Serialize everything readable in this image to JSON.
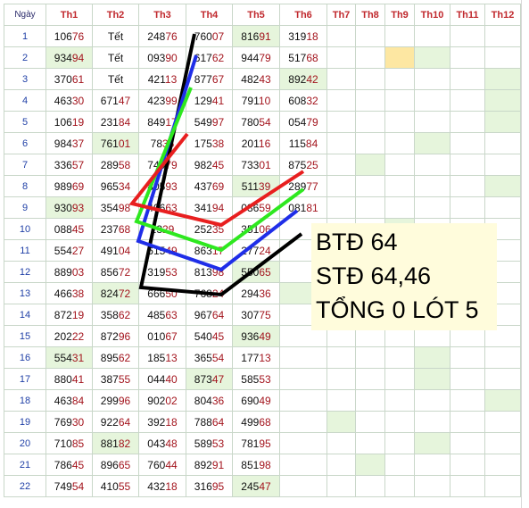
{
  "headers": [
    "Ngày",
    "Th1",
    "Th2",
    "Th3",
    "Th4",
    "Th5",
    "Th6",
    "Th7",
    "Th8",
    "Th9",
    "Th10",
    "Th11",
    "Th12"
  ],
  "rows": [
    {
      "day": "1",
      "vals": [
        "10676",
        "Tết",
        "24876",
        "76007",
        "81691",
        "31918"
      ]
    },
    {
      "day": "2",
      "vals": [
        "93494",
        "Tết",
        "09390",
        "61762",
        "94479",
        "51768"
      ]
    },
    {
      "day": "3",
      "vals": [
        "37061",
        "Tết",
        "42113",
        "87767",
        "48243",
        "89242"
      ]
    },
    {
      "day": "4",
      "vals": [
        "46330",
        "67147",
        "42399",
        "12941",
        "79110",
        "60832"
      ]
    },
    {
      "day": "5",
      "vals": [
        "10619",
        "23184",
        "84917",
        "54997",
        "78054",
        "05479"
      ]
    },
    {
      "day": "6",
      "vals": [
        "98437",
        "76101",
        "7835",
        "17538",
        "20116",
        "11584"
      ]
    },
    {
      "day": "7",
      "vals": [
        "33657",
        "28958",
        "74079",
        "98245",
        "73301",
        "87525"
      ]
    },
    {
      "day": "8",
      "vals": [
        "98969",
        "96534",
        "80593",
        "43769",
        "51139",
        "28977"
      ]
    },
    {
      "day": "9",
      "vals": [
        "93093",
        "35498",
        "40663",
        "34194",
        "03659",
        "08181"
      ]
    },
    {
      "day": "10",
      "vals": [
        "08845",
        "23768",
        "2329",
        "25235",
        "35106",
        ""
      ]
    },
    {
      "day": "11",
      "vals": [
        "55427",
        "49104",
        "61549",
        "86317",
        "27724",
        ""
      ]
    },
    {
      "day": "12",
      "vals": [
        "88903",
        "85672",
        "31953",
        "81398",
        "55065",
        ""
      ]
    },
    {
      "day": "13",
      "vals": [
        "46638",
        "82472",
        "66650",
        "76824",
        "29436",
        ""
      ]
    },
    {
      "day": "14",
      "vals": [
        "87219",
        "35862",
        "48563",
        "96764",
        "30775",
        ""
      ]
    },
    {
      "day": "15",
      "vals": [
        "20222",
        "87296",
        "01067",
        "54045",
        "93649",
        ""
      ]
    },
    {
      "day": "16",
      "vals": [
        "55431",
        "89562",
        "18513",
        "36554",
        "17713",
        ""
      ]
    },
    {
      "day": "17",
      "vals": [
        "88041",
        "38755",
        "04440",
        "87347",
        "58553",
        ""
      ]
    },
    {
      "day": "18",
      "vals": [
        "46384",
        "29996",
        "90202",
        "80436",
        "69049",
        ""
      ]
    },
    {
      "day": "19",
      "vals": [
        "76930",
        "92264",
        "39218",
        "78864",
        "49968",
        ""
      ]
    },
    {
      "day": "20",
      "vals": [
        "71085",
        "88182",
        "04348",
        "58953",
        "78195",
        ""
      ]
    },
    {
      "day": "21",
      "vals": [
        "78645",
        "89665",
        "76044",
        "89291",
        "85198",
        ""
      ]
    },
    {
      "day": "22",
      "vals": [
        "74954",
        "41055",
        "43218",
        "31695",
        "24547",
        ""
      ]
    }
  ],
  "note": {
    "line1": "BTĐ 64",
    "line2": "STĐ 64,46",
    "line3": "TỔNG 0 LÓT 5"
  },
  "colors": {
    "header_text": "#c0282d",
    "day_text": "#1f3fa6",
    "highlight_green": "#e6f5dc",
    "highlight_yellow": "#fde7a2",
    "note_bg": "#fffcdc",
    "line_black": "#000000",
    "line_blue": "#1f2ee8",
    "line_green": "#2ee81f",
    "line_red": "#e81f1f"
  }
}
